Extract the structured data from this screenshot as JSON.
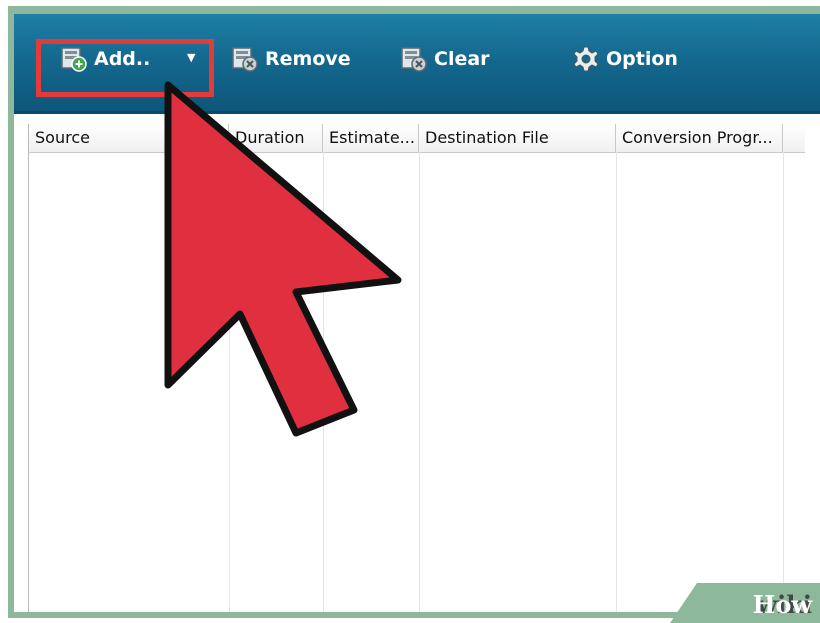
{
  "toolbar": {
    "add_label": "Add..",
    "remove_label": "Remove",
    "clear_label": "Clear",
    "option_label": "Option"
  },
  "table": {
    "columns": [
      "Source",
      "Duration",
      "Estimate...",
      "Destination File",
      "Conversion Progr..."
    ]
  },
  "watermark": {
    "part1": "wiki",
    "part2": "How"
  },
  "colors": {
    "toolbar": "#14698f",
    "highlight": "#e33a3a",
    "pointer": "#e0303f",
    "frame": "#8eb89c"
  }
}
